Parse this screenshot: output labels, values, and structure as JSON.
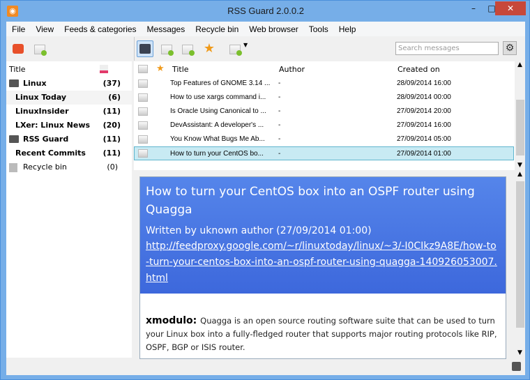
{
  "window": {
    "title": "RSS Guard 2.0.0.2",
    "app_icon": "rss-icon",
    "minimize": "–",
    "maximize": "□",
    "close": "✕"
  },
  "menu": [
    "File",
    "View",
    "Feeds & categories",
    "Messages",
    "Recycle bin",
    "Web browser",
    "Tools",
    "Help"
  ],
  "search": {
    "placeholder": "Search messages"
  },
  "feeds": {
    "header": "Title",
    "items": [
      {
        "label": "Linux",
        "count": "(37)",
        "type": "category"
      },
      {
        "label": "Linux Today",
        "count": "(6)",
        "type": "feed"
      },
      {
        "label": "LinuxInsider",
        "count": "(11)",
        "type": "feed"
      },
      {
        "label": "LXer: Linux News",
        "count": "(20)",
        "type": "feed"
      },
      {
        "label": "RSS Guard",
        "count": "(11)",
        "type": "category"
      },
      {
        "label": "Recent Commits",
        "count": "(11)",
        "type": "feed"
      },
      {
        "label": "Recycle bin",
        "count": "(0)",
        "type": "bin"
      }
    ]
  },
  "messages": {
    "columns": {
      "title": "Title",
      "author": "Author",
      "created": "Created on"
    },
    "rows": [
      {
        "title": "Top Features of GNOME 3.14 ...",
        "author": "-",
        "created": "28/09/2014 16:00"
      },
      {
        "title": "How to use xargs command i...",
        "author": "-",
        "created": "28/09/2014 00:00"
      },
      {
        "title": "Is Oracle Using Canonical to ...",
        "author": "-",
        "created": "27/09/2014 20:00"
      },
      {
        "title": "DevAssistant: A developer's ...",
        "author": "-",
        "created": "27/09/2014 16:00"
      },
      {
        "title": "You Know What Bugs Me Ab...",
        "author": "-",
        "created": "27/09/2014 05:00"
      },
      {
        "title": "How to turn your CentOS bo...",
        "author": "-",
        "created": "27/09/2014 01:00",
        "selected": true
      }
    ]
  },
  "preview": {
    "title": "How to turn your CentOS box into an OSPF router using Quagga",
    "byline": "Written by uknown author (27/09/2014 01:00)",
    "link": "http://feedproxy.google.com/~r/linuxtoday/linux/~3/-I0CIkz9A8E/how-to-turn-your-centos-box-into-an-ospf-router-using-quagga-140926053007.html",
    "source": "xmodulo",
    "body": "Quagga is an open source routing software suite that can be used to turn your Linux box into a fully-fledged router that supports major routing protocols like RIP, OSPF, BGP or ISIS router."
  },
  "colors": {
    "frame": "#76aee8",
    "selected_row": "#c8eaf3",
    "article_header": "#4a78e4",
    "close": "#c7483a"
  }
}
